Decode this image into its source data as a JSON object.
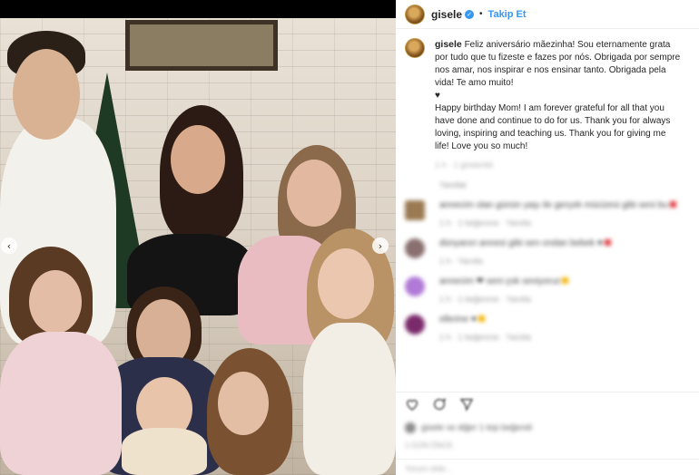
{
  "post": {
    "username": "gisele",
    "follow_label": "Takip Et",
    "caption_pt": "Feliz aniversário mãezinha! Sou eternamente grata por tudo que tu fizeste e fazes por nós. Obrigada por sempre nos amar, nos inspirar e nos ensinar tanto. Obrigada pela vida! Te amo muito!",
    "heart": "♥",
    "caption_en": "Happy birthday Mom! I am forever grateful for all that you have done and continue to do for us. Thank you for always loving, inspiring and teaching us. Thank you for giving me life! Love you so much!",
    "time_blurred": "1 h · 1 gösterildi",
    "section_blurred": "Yanıtlar"
  },
  "comments": [
    {
      "text": "annecim olan günün yaşı ile gerçek mücizesi gibi seni bu",
      "meta": "1 h · 1 beğenme · Yanıtla",
      "avatar_color": "#9a7a52"
    },
    {
      "text": "dünyanın annesi gibi sen ondan bebek ♥",
      "meta": "1 h · Yanıtla",
      "avatar_color": "#8a6f6f"
    },
    {
      "text": "annecim ❤ seni çok seviyoruz",
      "meta": "1 h · 1 beğenme · Yanıtla",
      "avatar_color": "#b07ad6"
    },
    {
      "text": "ellerine ♥",
      "meta": "1 h · 1 beğenme · Yanıtla",
      "avatar_color": "#7a2a6a"
    }
  ],
  "footer": {
    "likes_text": "gisele ve diğer 1 kişi beğendi",
    "date_text": "1 GÜN ÖNCE",
    "add_comment": "Yorum ekle..."
  },
  "colors": {
    "accent": "#3897f0",
    "verified": "#3897f0"
  }
}
